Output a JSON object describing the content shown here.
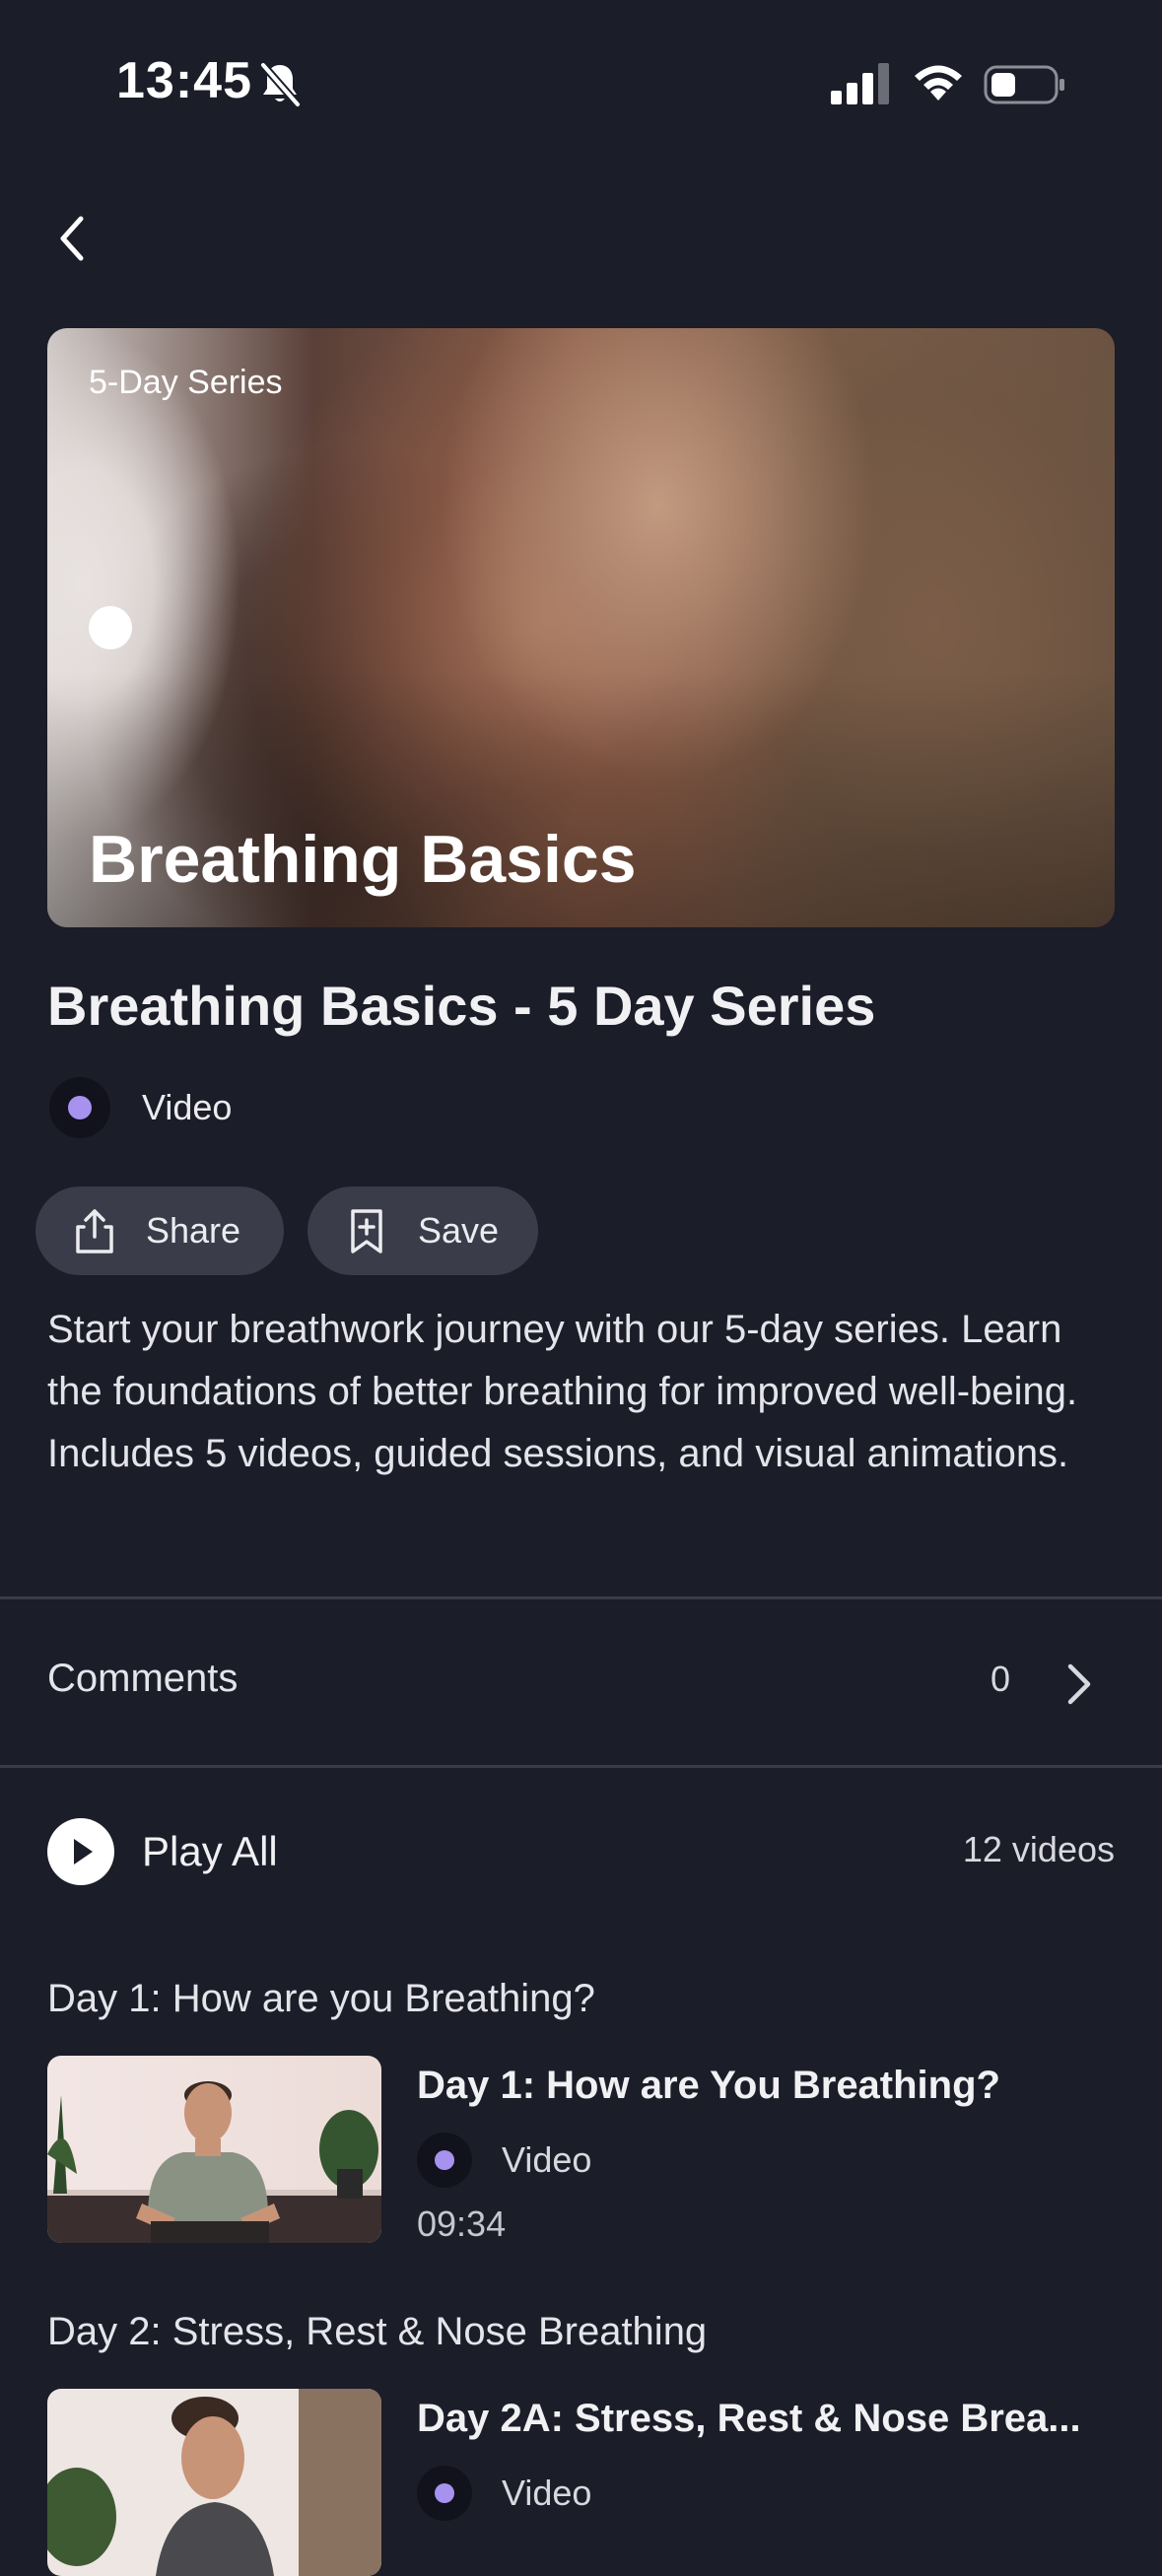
{
  "status_bar": {
    "time": "13:45",
    "icons": [
      "bell-slash-icon",
      "cellular-signal-icon",
      "wifi-icon",
      "battery-icon"
    ]
  },
  "nav": {
    "back_icon": "chevron-left-icon"
  },
  "hero": {
    "tag": "5-Day Series",
    "title": "Breathing Basics"
  },
  "content": {
    "title": "Breathing Basics - 5 Day Series",
    "media_type": "Video",
    "accent_color": "#a792ef",
    "actions": {
      "share_label": "Share",
      "save_label": "Save"
    },
    "description": "Start your breathwork journey with our 5-day series. Learn the foundations of better breathing for improved well-being. Includes 5 videos, guided sessions, and visual animations."
  },
  "comments": {
    "label": "Comments",
    "count": "0"
  },
  "playlist": {
    "play_all_label": "Play All",
    "video_count": "12 videos",
    "days": [
      {
        "header": "Day 1: How are you Breathing?",
        "episode": {
          "title": "Day 1: How are You Breathing?",
          "type": "Video",
          "duration": "09:34"
        }
      },
      {
        "header": "Day 2: Stress, Rest & Nose Breathing",
        "episode": {
          "title": "Day 2A: Stress, Rest & Nose Brea...",
          "type": "Video",
          "duration": ""
        }
      }
    ]
  },
  "colors": {
    "background": "#1b1d28",
    "pill_background": "#3a3d49",
    "accent": "#a792ef"
  }
}
